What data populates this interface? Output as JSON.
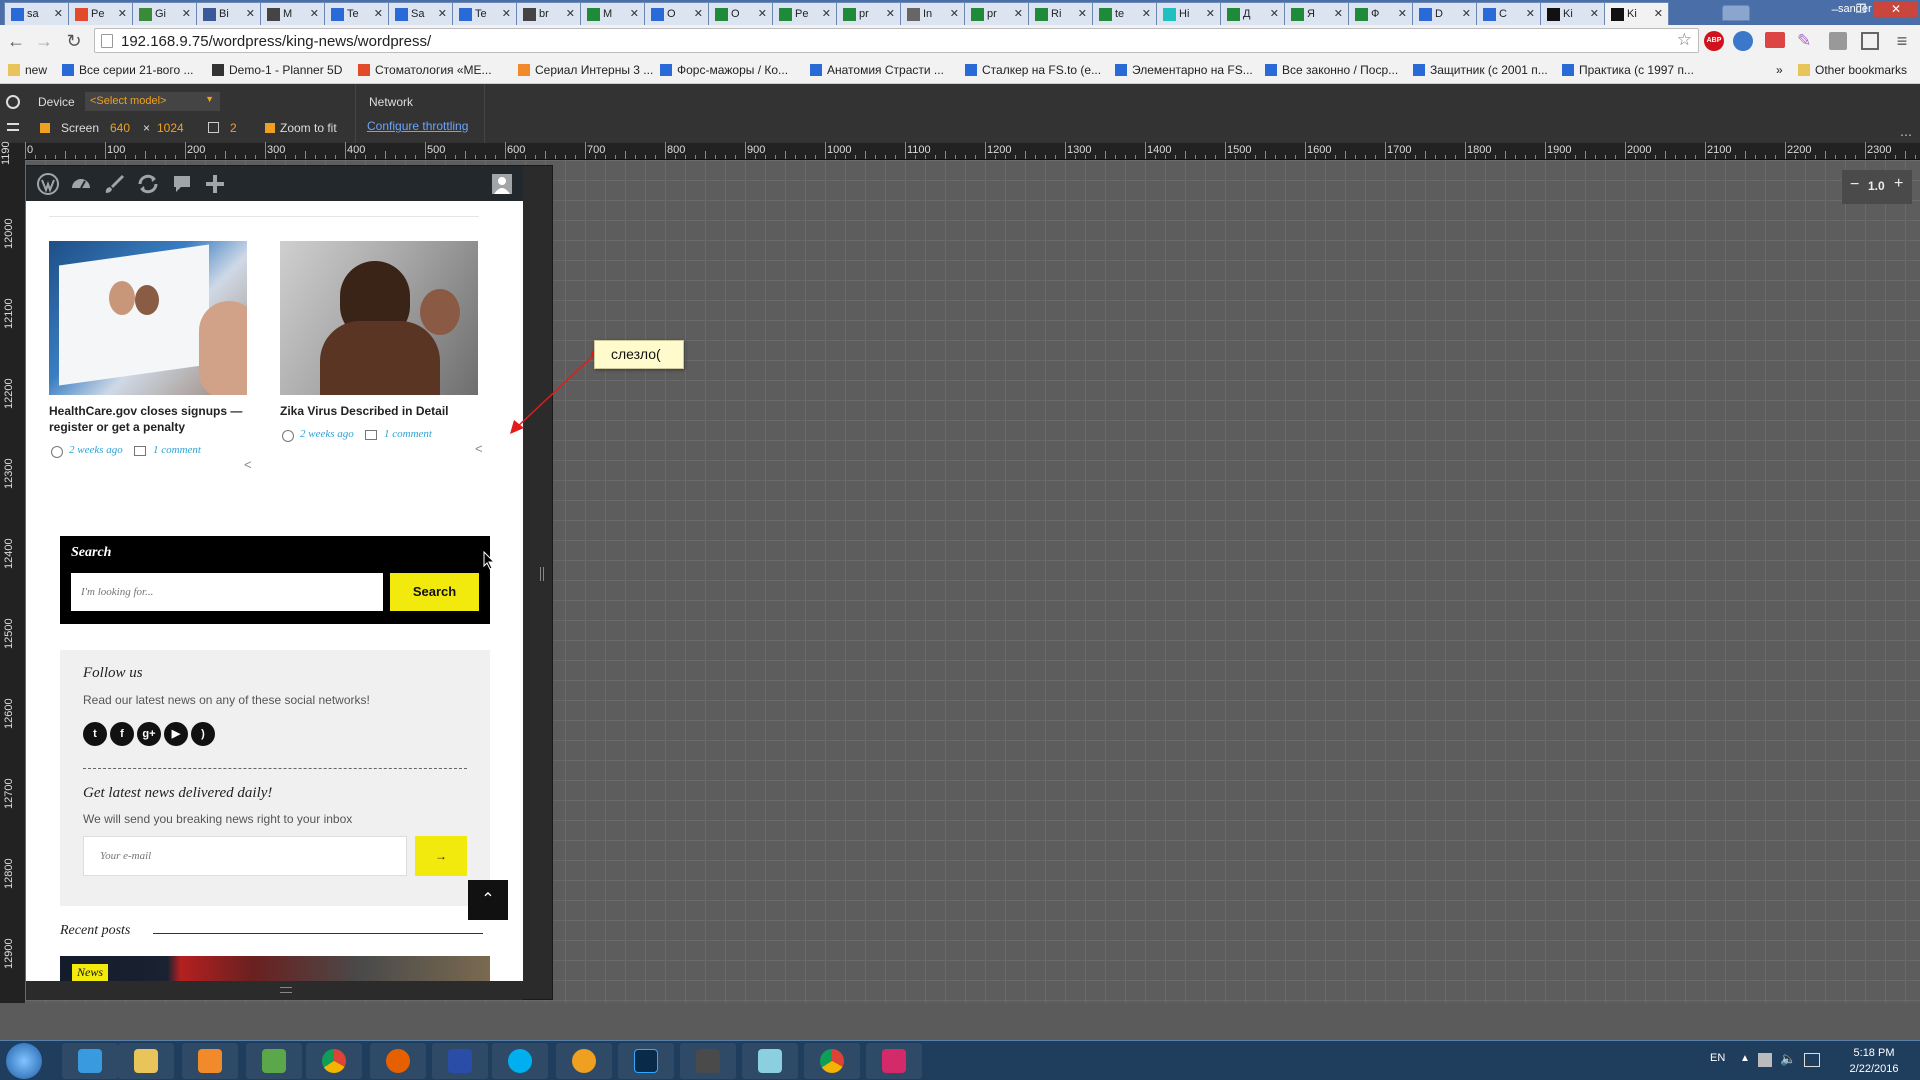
{
  "browser": {
    "tabs": [
      "sa",
      "Pe",
      "Gi",
      "Bi",
      "M",
      "Te",
      "Sa",
      "Te",
      "br",
      "M",
      "O",
      "O",
      "Pe",
      "pr",
      "In",
      "pr",
      "Ri",
      "te",
      "Hi",
      "Д",
      "Я",
      "Ф",
      "D",
      "C",
      "Ki",
      "Ki"
    ],
    "user": "sander",
    "url": "192.168.9.75/wordpress/king-news/wordpress/",
    "bookmarks": [
      "new",
      "Все серии 21-вого ...",
      "Demo-1 - Planner 5D",
      "Стоматология «МЕ...",
      "Сериал Интерны 3 ...",
      "Форс-мажоры / Ко...",
      "Анатомия Страсти ...",
      "Сталкер на FS.to (е...",
      "Элементарно на FS...",
      "Все законно / Поср...",
      "Защитник (с 2001 п...",
      "Практика (с 1997 п..."
    ],
    "other_bookmarks": "Other bookmarks",
    "overflow": "»"
  },
  "devtools": {
    "device_label": "Device",
    "model_placeholder": "<Select model>",
    "network_label": "Network",
    "screen_label": "Screen",
    "screen_width": "640",
    "screen_x": "×",
    "screen_height": "1024",
    "dpr": "2",
    "zoom_to_fit": "Zoom to fit",
    "throttling": "Configure throttling",
    "zoom_value": "1.0",
    "hruler": [
      "0",
      "100",
      "200",
      "300",
      "400",
      "500",
      "600",
      "700",
      "800",
      "900",
      "1000",
      "1100",
      "1200",
      "1300",
      "1400",
      "1500",
      "1600",
      "1700",
      "1800",
      "1900",
      "2000",
      "2100",
      "2200",
      "2300"
    ],
    "vruler": [
      "12000",
      "12100",
      "12200",
      "12300",
      "12400",
      "12500",
      "12600",
      "12700",
      "12800",
      "12900"
    ],
    "vruler_top": "1190"
  },
  "site": {
    "posts": [
      {
        "title": "HealthCare.gov closes signups — register or get a penalty",
        "date": "2 weeks ago",
        "comments": "1 comment"
      },
      {
        "title": "Zika Virus Described in Detail",
        "date": "2 weeks ago",
        "comments": "1 comment"
      }
    ],
    "search": {
      "title": "Search",
      "placeholder": "I'm looking for...",
      "button": "Search"
    },
    "follow": {
      "title": "Follow us",
      "text": "Read our latest news on any of these social networks!",
      "icons": [
        "twitter-icon",
        "facebook-icon",
        "google-plus-icon",
        "youtube-icon",
        "rss-icon"
      ]
    },
    "newsletter": {
      "title": "Get latest news delivered daily!",
      "text": "We will send you breaking news right to your inbox",
      "placeholder": "Your e-mail",
      "button": "→"
    },
    "recent_title": "Recent posts",
    "recent_badge": "News"
  },
  "annotation": {
    "text": "слезло("
  },
  "taskbar": {
    "lang": "EN",
    "time": "5:18 PM",
    "date": "2/22/2016"
  },
  "colors": {
    "accent_yellow": "#f2ea0c",
    "link_blue": "#2ea3d6",
    "admin_bar": "#23282d",
    "arrow_red": "#e21b1b"
  }
}
